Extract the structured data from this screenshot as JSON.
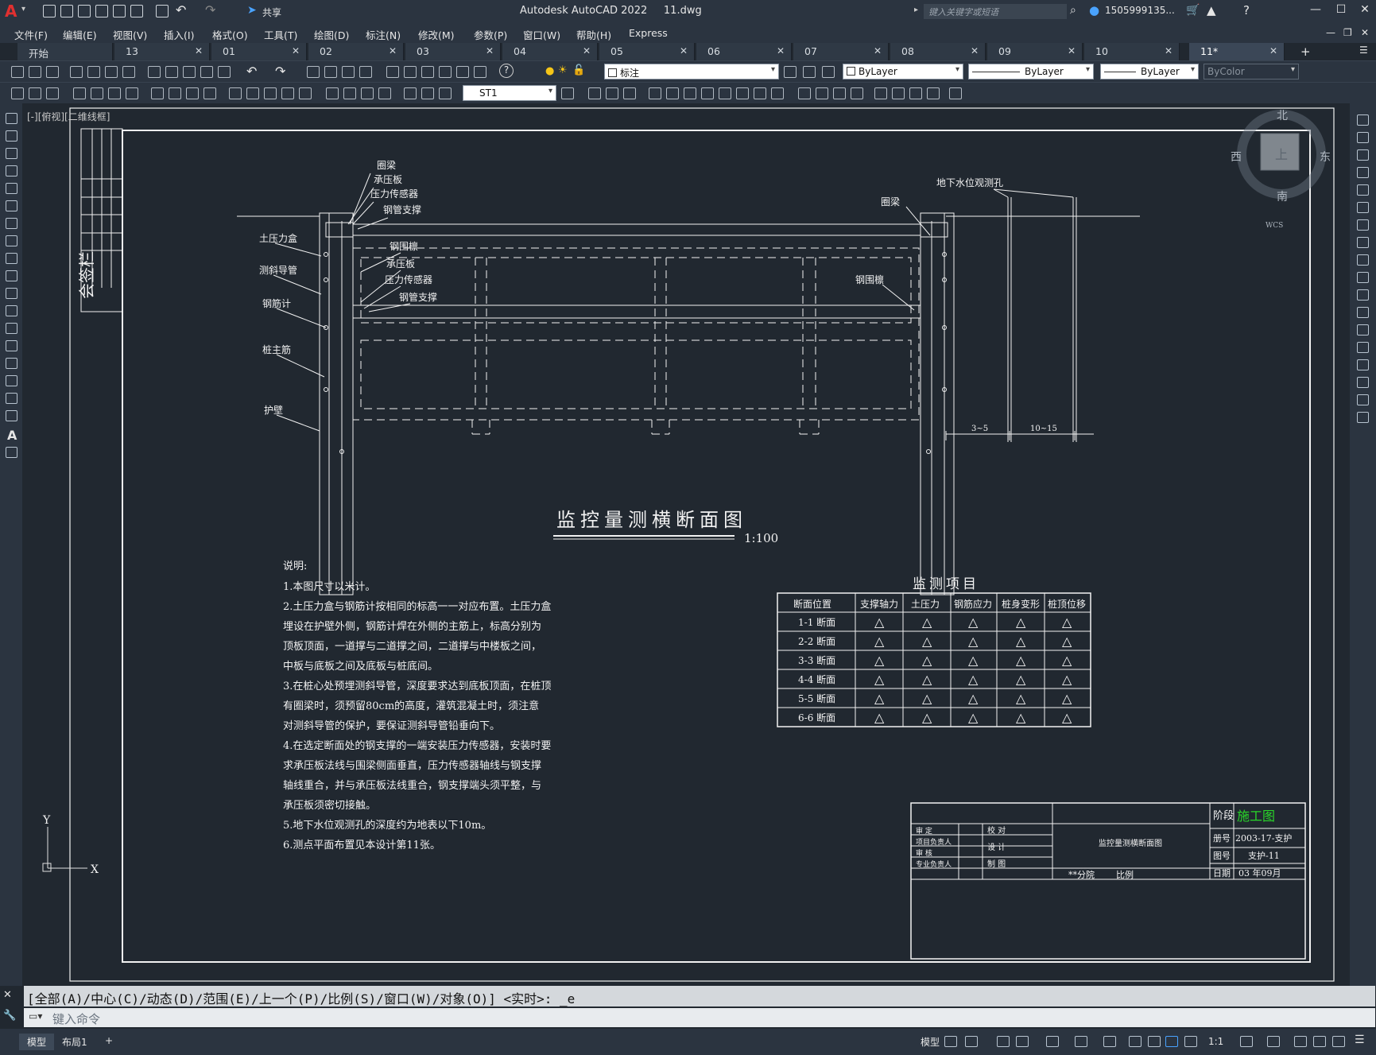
{
  "titlebar": {
    "logo": "A",
    "share": "共享",
    "app_title": "Autodesk AutoCAD 2022     11.dwg",
    "search_placeholder": "键入关键字或短语",
    "user": "1505999135..."
  },
  "menu": [
    "文件(F)",
    "编辑(E)",
    "视图(V)",
    "插入(I)",
    "格式(O)",
    "工具(T)",
    "绘图(D)",
    "标注(N)",
    "修改(M)",
    "参数(P)",
    "窗口(W)",
    "帮助(H)",
    "Express"
  ],
  "tabs": [
    "开始",
    "13",
    "01",
    "02",
    "03",
    "04",
    "05",
    "06",
    "07",
    "08",
    "09",
    "10",
    "11*"
  ],
  "toolbar": {
    "layer": "标注",
    "color": "ByLayer",
    "linetype": "ByLayer",
    "lineweight": "ByLayer",
    "plotstyle": "ByColor",
    "textstyle": "ST1"
  },
  "view_label": "[-][俯视][二维线框]",
  "viewcube": {
    "north": "北",
    "south": "南",
    "east": "东",
    "west": "西",
    "top": "上",
    "wcs": "WCS"
  },
  "drawing": {
    "sign_column": "会签栏",
    "labels_left": [
      "圈梁",
      "承压板",
      "压力传感器",
      "钢管支撑",
      "土压力盒",
      "测斜导管",
      "钢围檩",
      "承压板",
      "压力传感器",
      "钢筋计",
      "钢管支撑",
      "桩主筋",
      "护壁"
    ],
    "labels_right": [
      "地下水位观测孔",
      "圈梁",
      "钢围檩"
    ],
    "dim1": "3~5",
    "dim2": "10~15",
    "title": "监控量测横断面图",
    "scale": "1:100",
    "notes_title": "说明:",
    "notes": [
      "1.本图尺寸以米计。",
      "2.土压力盒与钢筋计按相同的标高一一对应布置。土压力盒",
      "  埋设在护壁外侧，钢筋计焊在外侧的主筋上，标高分别为",
      "  顶板顶面，一道撑与二道撑之间，二道撑与中楼板之间，",
      "  中板与底板之间及底板与桩底间。",
      "3.在桩心处预埋测斜导管，深度要求达到底板顶面，在桩顶",
      "  有圈梁时，须预留80cm的高度，灌筑混凝土时，须注意",
      "  对测斜导管的保护，要保证测斜导管铅垂向下。",
      "4.在选定断面处的钢支撑的一端安装压力传感器，安装时要",
      "  求承压板法线与围梁侧面垂直，压力传感器轴线与钢支撑",
      "  轴线重合，并与承压板法线重合，钢支撑端头须平整，与",
      "  承压板须密切接触。",
      "5.地下水位观测孔的深度约为地表以下10m。",
      "6.测点平面布置见本设计第11张。"
    ],
    "monitor_title": "监测项目",
    "monitor_headers": [
      "断面位置",
      "支撑轴力",
      "土压力",
      "钢筋应力",
      "桩身变形",
      "桩顶位移"
    ],
    "monitor_rows": [
      "1-1 断面",
      "2-2 断面",
      "3-3 断面",
      "4-4 断面",
      "5-5 断面",
      "6-6 断面"
    ],
    "monitor_mark": "△",
    "titleblock": {
      "stage_label": "阶段",
      "stage": "施工图",
      "book_label": "册号",
      "book": "2003-17-支护",
      "drawing_no_label": "图号",
      "drawing_no": "支护-11",
      "date_label": "日期",
      "date_value": "03 年09月",
      "name": "监控量测横断面图",
      "roles": [
        "审  定",
        "项目负责人",
        "审  核",
        "专业负责人"
      ],
      "roles2": [
        "校  对",
        "设  计",
        "制  图"
      ],
      "company": "**分院",
      "scale_label": "比例"
    }
  },
  "command": {
    "history": "[全部(A)/中心(C)/动态(D)/范围(E)/上一个(P)/比例(S)/窗口(W)/对象(O)] <实时>: _e",
    "placeholder": "键入命令"
  },
  "status": {
    "model": "模型",
    "layout1": "布局1",
    "add": "+",
    "model_btn": "模型",
    "annoscale": "1:1"
  },
  "ucs": {
    "x": "X",
    "y": "Y"
  }
}
